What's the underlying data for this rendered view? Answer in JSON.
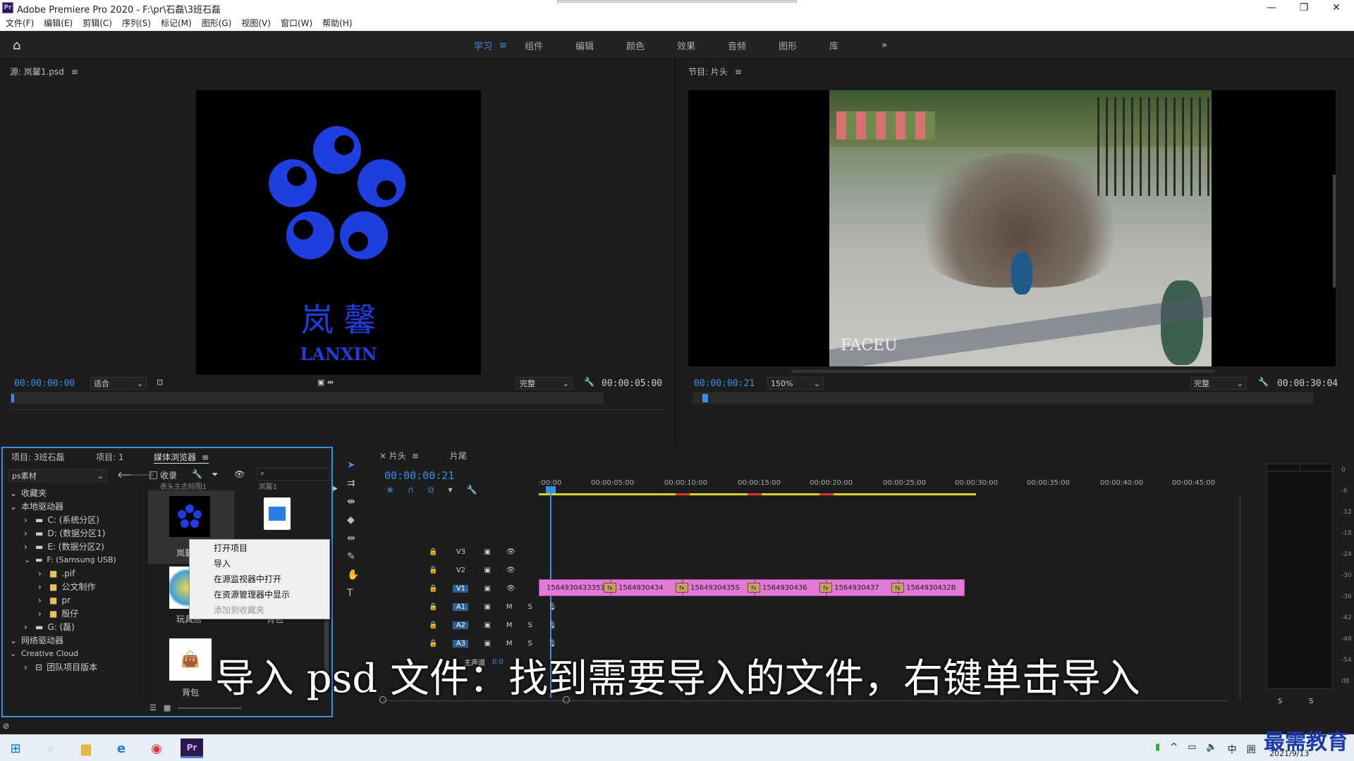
{
  "app": {
    "title": "Adobe Premiere Pro 2020 - F:\\pr\\石磊\\3班石磊",
    "logo": "Pr"
  },
  "menu": [
    "文件(F)",
    "编辑(E)",
    "剪辑(C)",
    "序列(S)",
    "标记(M)",
    "图形(G)",
    "视图(V)",
    "窗口(W)",
    "帮助(H)"
  ],
  "workspaces": [
    {
      "label": "学习",
      "active": true
    },
    {
      "label": "组件"
    },
    {
      "label": "编辑"
    },
    {
      "label": "颜色"
    },
    {
      "label": "效果"
    },
    {
      "label": "音频"
    },
    {
      "label": "图形"
    },
    {
      "label": "库"
    }
  ],
  "workspace_more": "»",
  "source": {
    "title": "源: 岚馨1.psd",
    "logo_chars": "岚 馨",
    "logo_en": "LANXIN",
    "timecode": "00:00:00:00",
    "fit": "适合",
    "quality": "完整",
    "duration": "00:00:05:00"
  },
  "program": {
    "title": "节目: 片头",
    "watermark": "FACEU",
    "timecode": "00:00:00:21",
    "zoom": "150%",
    "quality": "完整",
    "duration": "00:00:30:04"
  },
  "project": {
    "tabs": [
      "项目: 3班石磊",
      "项目: 1",
      "媒体浏览器"
    ],
    "path": "ps素材",
    "ingest": "收录",
    "tree": [
      {
        "label": "收藏夹",
        "indent": 0,
        "arrow": "v"
      },
      {
        "label": "本地驱动器",
        "indent": 0,
        "arrow": "v"
      },
      {
        "label": "C: (系统分区)",
        "indent": 2,
        "arrow": ">"
      },
      {
        "label": "D: (数据分区1)",
        "indent": 2,
        "arrow": ">"
      },
      {
        "label": "E: (数据分区2)",
        "indent": 2,
        "arrow": ">"
      },
      {
        "label": "F: (Samsung USB)",
        "indent": 2,
        "arrow": "v"
      },
      {
        "label": ".pif",
        "indent": 3,
        "arrow": ">"
      },
      {
        "label": "公文制作",
        "indent": 3,
        "arrow": ">"
      },
      {
        "label": "pr",
        "indent": 3,
        "arrow": ">"
      },
      {
        "label": "殷仔",
        "indent": 3,
        "arrow": ">"
      },
      {
        "label": "G: (磊)",
        "indent": 2,
        "arrow": ">"
      },
      {
        "label": "网络驱动器",
        "indent": 0,
        "arrow": "v"
      },
      {
        "label": "Creative Cloud",
        "indent": 0,
        "arrow": "v"
      },
      {
        "label": "团队项目版本",
        "indent": 2,
        "arrow": ">"
      }
    ],
    "thumbs": [
      "岚馨",
      "玩具店",
      "背包",
      "背包"
    ],
    "thumb_top_labels": [
      "表头主志标图1",
      "岚馨1"
    ]
  },
  "context_menu": [
    {
      "label": "打开项目",
      "disabled": false
    },
    {
      "label": "导入",
      "disabled": false
    },
    {
      "label": "在源监视器中打开",
      "disabled": false
    },
    {
      "label": "在资源管理器中显示",
      "disabled": false
    },
    {
      "label": "添加到收藏夹",
      "disabled": true
    }
  ],
  "timeline": {
    "tabs": [
      "片头",
      "片尾"
    ],
    "timecode": "00:00:00:21",
    "ruler": [
      ":00:00",
      "00:00:05:00",
      "00:00:10:00",
      "00:00:15:00",
      "00:00:20:00",
      "00:00:25:00",
      "00:00:30:00",
      "00:00:35:00",
      "00:00:40:00",
      "00:00:45:00"
    ],
    "video_tracks": [
      "V3",
      "V2",
      "V1"
    ],
    "audio_tracks": [
      "A1",
      "A2",
      "A3"
    ],
    "clips": [
      "1564930433351",
      "1564930434",
      "1564930435S",
      "1564930436",
      "1564930437",
      "1564930432B"
    ],
    "fx_label": "fx",
    "master_label": "主声道",
    "master_value": "0.0"
  },
  "meter": {
    "scale": [
      "0",
      "-6",
      "-12",
      "-18",
      "-24",
      "-30",
      "-36",
      "-42",
      "-48",
      "-54",
      "dB"
    ],
    "solo": [
      "S",
      "S"
    ]
  },
  "subtitle": "导入 psd 文件：找到需要导入的文件，右键单击导入",
  "taskbar": {
    "tray": [
      "^",
      "中",
      "囲"
    ],
    "time": "",
    "date": "2021/9/13"
  },
  "watermark": "最需教育"
}
